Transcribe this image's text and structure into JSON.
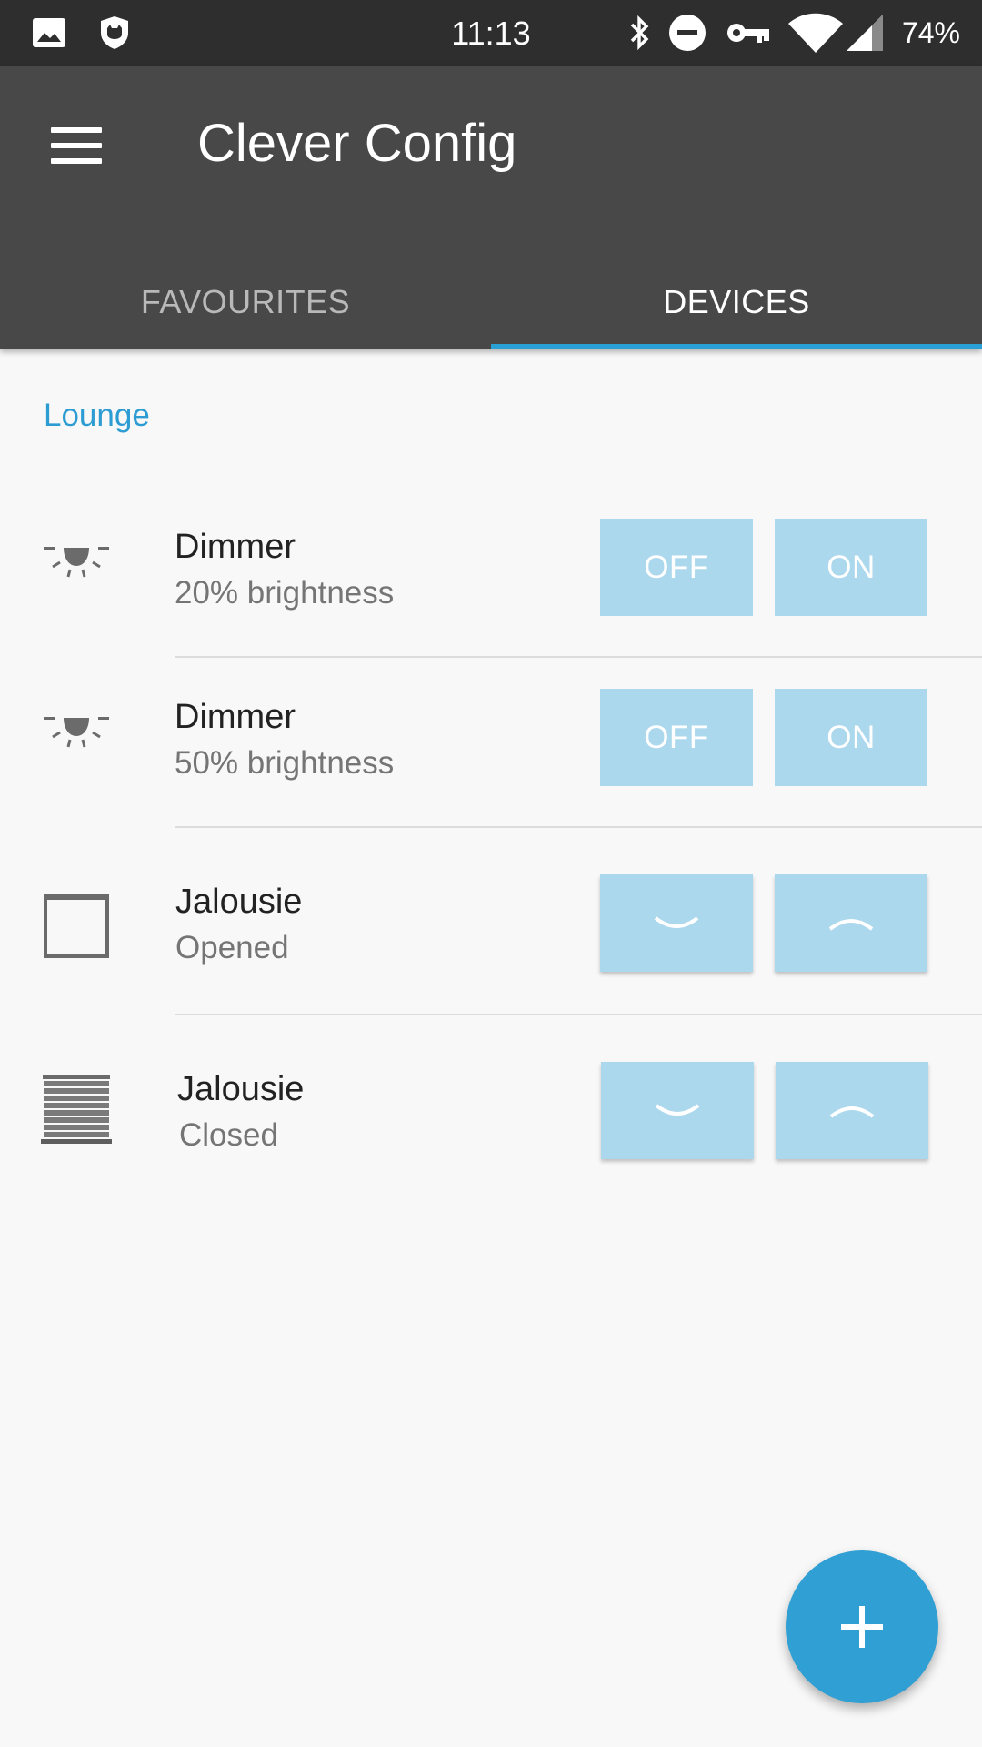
{
  "status_bar": {
    "time": "11:13",
    "battery": "74%",
    "icons": [
      "image-icon",
      "shield-cat-icon",
      "bluetooth-icon",
      "do-not-disturb-icon",
      "vpn-key-icon",
      "wifi-icon",
      "signal-icon"
    ]
  },
  "app_bar": {
    "title": "Clever Config",
    "menu_icon": "hamburger-menu-icon"
  },
  "tabs": [
    {
      "label": "FAVOURITES",
      "selected": false
    },
    {
      "label": "DEVICES",
      "selected": true
    }
  ],
  "section": {
    "title": "Lounge"
  },
  "devices": [
    {
      "icon": "dimmer-light-icon",
      "name": "Dimmer",
      "status": "20% brightness",
      "buttons": [
        "OFF",
        "ON"
      ]
    },
    {
      "icon": "dimmer-light-icon",
      "name": "Dimmer",
      "status": "50% brightness",
      "buttons": [
        "OFF",
        "ON"
      ]
    },
    {
      "icon": "jalousie-open-icon",
      "name": "Jalousie",
      "status": "Opened",
      "buttons": [
        "chevron-down-icon",
        "chevron-up-icon"
      ]
    },
    {
      "icon": "jalousie-closed-icon",
      "name": "Jalousie",
      "status": "Closed",
      "buttons": [
        "chevron-down-icon",
        "chevron-up-icon"
      ]
    }
  ],
  "fab": {
    "icon": "add-icon"
  },
  "colors": {
    "status_bar": "#2e2e2e",
    "app_bar": "#484848",
    "accent": "#2aa1d6",
    "control_button": "#acd8ed",
    "fab": "#2f9fd4",
    "background": "#f8f8f8"
  }
}
